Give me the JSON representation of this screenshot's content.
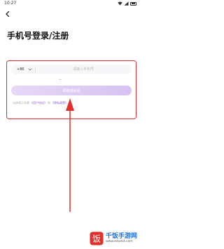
{
  "status_bar": {
    "time": "10:27"
  },
  "header": {
    "title": "手机号登录/注册"
  },
  "form": {
    "country_code": "+86",
    "phone_placeholder": "请输入手机号",
    "dots": "··",
    "submit_label": "获取验证码",
    "agreement_prefix": "勾选表示同意",
    "user_agreement": "《用户协议》",
    "and": "和",
    "privacy_policy": "《隐私政策》"
  },
  "watermark": {
    "title": "千饭手游网",
    "url": "www.eduext.com",
    "logo_char": "饭"
  },
  "colors": {
    "accent": "#8b5cd6",
    "annotation": "#e0302a",
    "button_start": "#e6d8f6",
    "button_end": "#d7c2f1"
  }
}
